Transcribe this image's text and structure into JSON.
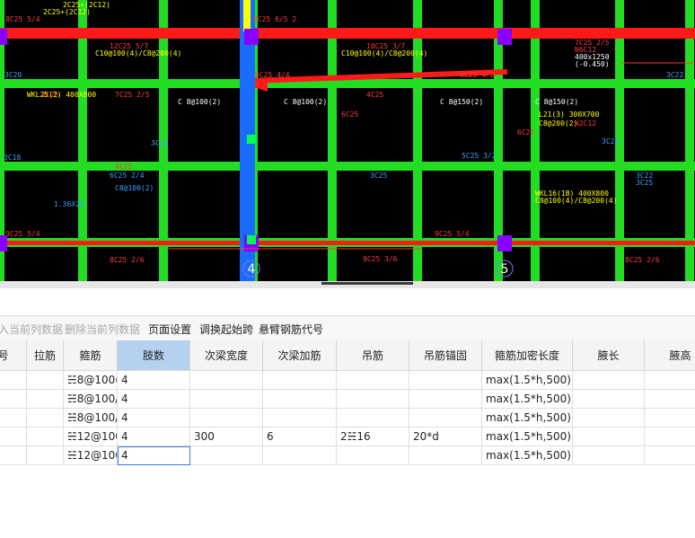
{
  "cad": {
    "axis_labels": [
      "4",
      "5"
    ],
    "texts": [
      {
        "t": "8C25 5/4",
        "c": "#ff3a3a"
      },
      {
        "t": "2C25+(2C12)",
        "c": "#ffff00"
      },
      {
        "t": "8C25 6/5 2",
        "c": "#ff3a3a"
      },
      {
        "t": "2C25+(2C12)",
        "c": "#ffff00"
      },
      {
        "t": "12C25 5/7",
        "c": "#ff3a3a"
      },
      {
        "t": "C10@100(4)/C8@200(4)",
        "c": "#ffff00"
      },
      {
        "t": "10C25 3/7",
        "c": "#ff3a3a"
      },
      {
        "t": "C10@100(4)/C8@200(4)",
        "c": "#ffff00"
      },
      {
        "t": "7C25 2/5",
        "c": "#ff3a3a"
      },
      {
        "t": "N6C12",
        "c": "#ff3a3a"
      },
      {
        "t": "400x1250",
        "c": "#ffffff"
      },
      {
        "t": "(-0.450)",
        "c": "#ffffff"
      },
      {
        "t": "8C25 4/4",
        "c": "#ff3a3a"
      },
      {
        "t": "6C25 4/2",
        "c": "#ff3a3a"
      },
      {
        "t": "3C20",
        "c": "#3aa0ff"
      },
      {
        "t": "3C22",
        "c": "#3aa0ff"
      },
      {
        "t": "7C25 2/5",
        "c": "#ff3a3a"
      },
      {
        "t": "C 8@100(2)",
        "c": "#ffffff"
      },
      {
        "t": "C 8@100(2)",
        "c": "#ffffff"
      },
      {
        "t": "C 8@150(2)",
        "c": "#ffffff"
      },
      {
        "t": "C 8@150(2)",
        "c": "#ffffff"
      },
      {
        "t": "4C25",
        "c": "#ff3a3a"
      },
      {
        "t": "4C25",
        "c": "#ff3a3a"
      },
      {
        "t": "WKL25(2) 400X800",
        "c": "#ffff00"
      },
      {
        "t": "L21(3) 300X700",
        "c": "#ffff00"
      },
      {
        "t": "C8@200(2)",
        "c": "#ffff00"
      },
      {
        "t": "3C18",
        "c": "#3aa0ff"
      },
      {
        "t": "6C25 2/4",
        "c": "#3aa0ff"
      },
      {
        "t": "3C25",
        "c": "#3aa0ff"
      },
      {
        "t": "5C25 3/2",
        "c": "#3aa0ff"
      },
      {
        "t": "3C22",
        "c": "#3aa0ff"
      },
      {
        "t": "C8@100(2)",
        "c": "#3aa0ff"
      },
      {
        "t": "WKL16(1B) 400X800",
        "c": "#ffff00"
      },
      {
        "t": "C8@100(4)/C8@200(4)",
        "c": "#ffff00"
      },
      {
        "t": "9C25 5/4",
        "c": "#ff3a3a"
      },
      {
        "t": "9C25 5/4",
        "c": "#ff3a3a"
      },
      {
        "t": "8C25 2/6",
        "c": "#ff3a3a"
      },
      {
        "t": "9C25 3/6",
        "c": "#ff3a3a"
      },
      {
        "t": "8C25 2/6",
        "c": "#ff3a3a"
      },
      {
        "t": "6C25",
        "c": "#ff3a3a"
      },
      {
        "t": "3C20",
        "c": "#3aa0ff"
      },
      {
        "t": "1.36X24",
        "c": "#3aa0ff"
      },
      {
        "t": "N2C12",
        "c": "#ff3a3a"
      },
      {
        "t": "6C25",
        "c": "#ff3a3a"
      },
      {
        "t": "3C20",
        "c": "#3aa0ff"
      },
      {
        "t": "4C25",
        "c": "#ff3a3a"
      },
      {
        "t": "3C25",
        "c": "#3aa0ff"
      }
    ]
  },
  "toolbar": [
    {
      "label": "入当前列数据",
      "disabled": true
    },
    {
      "label": "删除当前列数据",
      "disabled": true
    },
    {
      "label": "页面设置",
      "disabled": false
    },
    {
      "label": "调换起始跨",
      "disabled": false
    },
    {
      "label": "悬臂钢筋代号",
      "disabled": false
    }
  ],
  "table": {
    "headers": [
      "号",
      "拉筋",
      "箍筋",
      "肢数",
      "次梁宽度",
      "次梁加筋",
      "吊筋",
      "吊筋锚固",
      "箍筋加密长度",
      "腋长",
      "腋高"
    ],
    "active_header": "肢数",
    "rows": [
      [
        "",
        "",
        "☵8@100(",
        "4",
        "",
        "",
        "",
        "",
        "max(1.5*h,500)",
        "",
        ""
      ],
      [
        "",
        "",
        "☵8@100/",
        "4",
        "",
        "",
        "",
        "",
        "max(1.5*h,500)",
        "",
        ""
      ],
      [
        "",
        "",
        "☵8@100/",
        "4",
        "",
        "",
        "",
        "",
        "max(1.5*h,500)",
        "",
        ""
      ],
      [
        "",
        "",
        "☵12@100",
        "4",
        "300",
        "6",
        "2☵16",
        "20*d",
        "max(1.5*h,500)",
        "",
        ""
      ],
      [
        "",
        "",
        "☵12@100",
        "4",
        "",
        "",
        "",
        "",
        "max(1.5*h,500)",
        "",
        ""
      ]
    ],
    "selected_row": 4,
    "selected_col": 3
  },
  "colors": {
    "cad_bg": "#000000",
    "beam_green": "#22dd22",
    "beam_red": "#ff1a1a",
    "column_purple": "#8800ff",
    "selected_beam_blue": "#1a6cff",
    "header_active": "#b4d2f0",
    "selection_outline": "#3a7bd5"
  }
}
